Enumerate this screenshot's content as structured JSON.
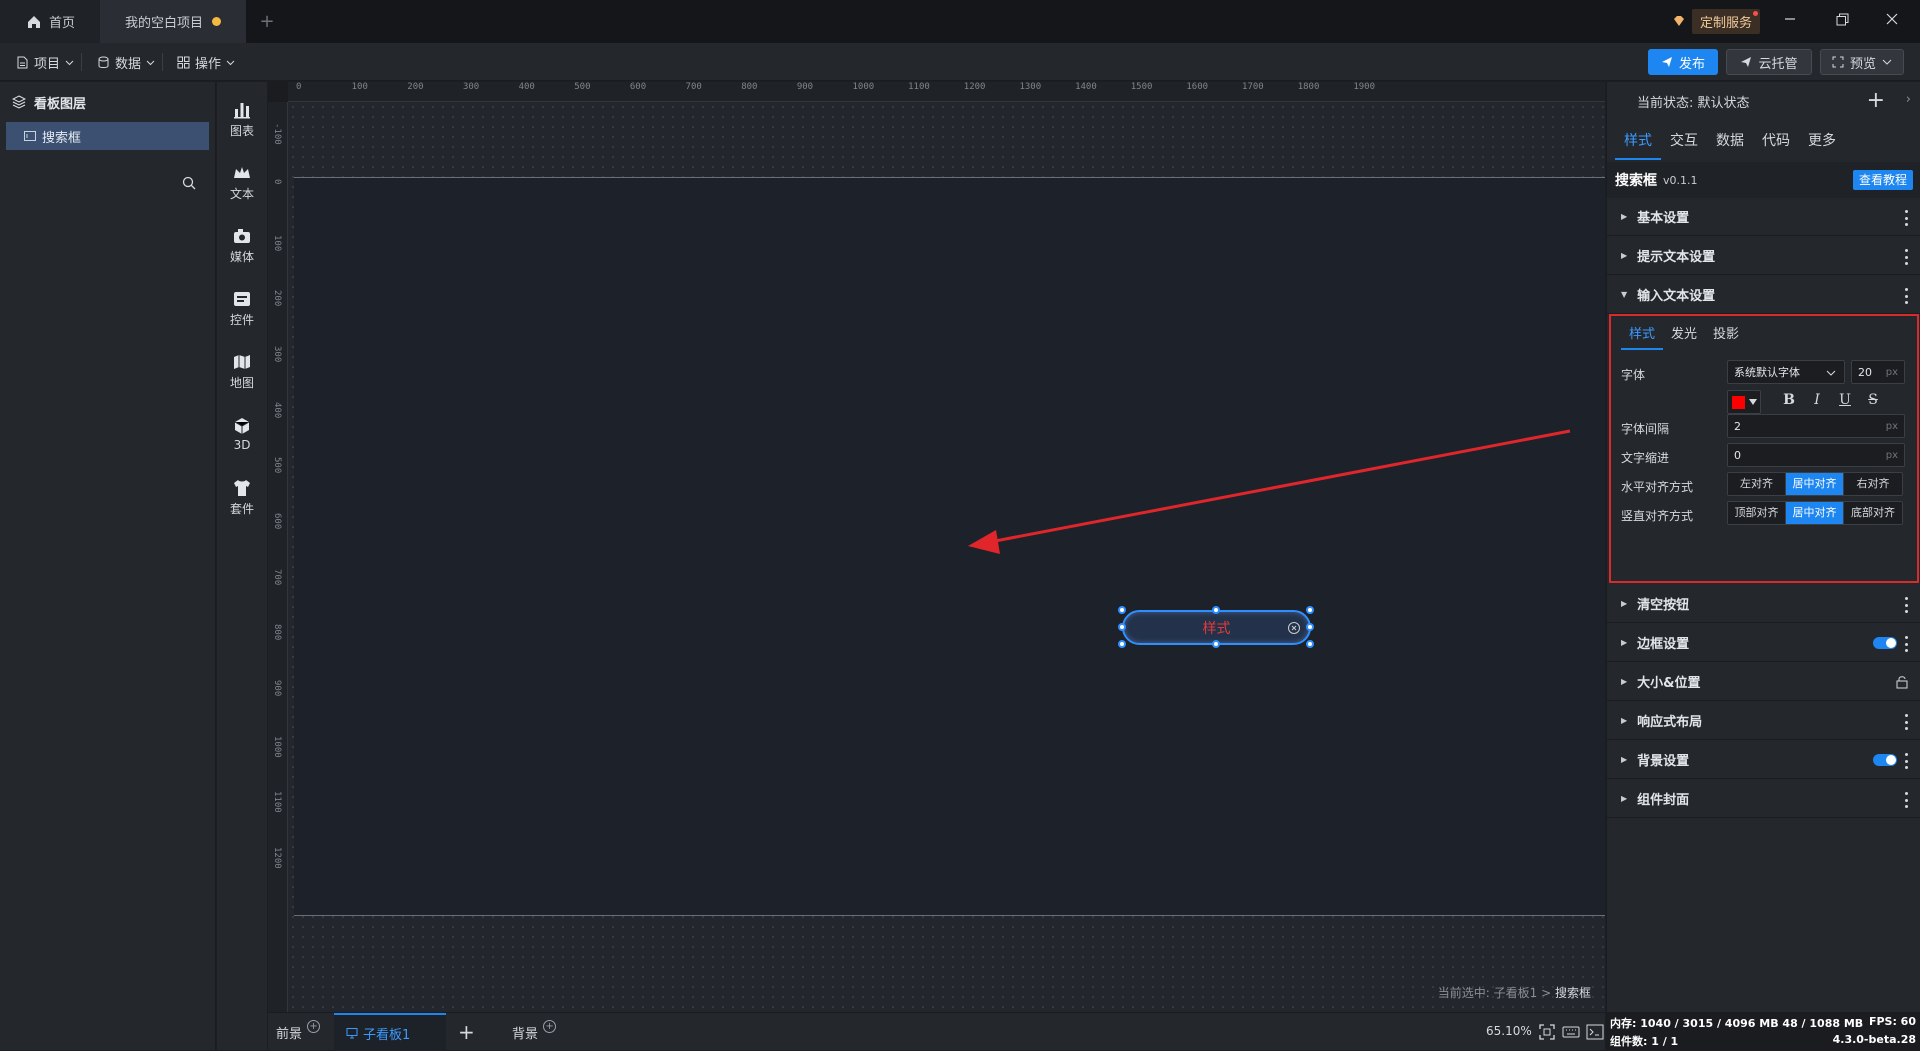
{
  "titlebar": {
    "home_tab": "首页",
    "project_tab": "我的空白项目",
    "custom_service": "定制服务"
  },
  "menubar": {
    "project": "项目",
    "data": "数据",
    "ops": "操作",
    "publish": "发布",
    "cloud": "云托管",
    "preview": "预览"
  },
  "layers": {
    "title": "看板图层",
    "items": [
      "搜索框"
    ]
  },
  "library": {
    "items": [
      "图表",
      "文本",
      "媒体",
      "控件",
      "地图",
      "3D",
      "套件"
    ]
  },
  "canvas": {
    "ruler_h": [
      "0",
      "100",
      "200",
      "300",
      "400",
      "500",
      "600",
      "700",
      "800",
      "900",
      "1000",
      "1100",
      "1200",
      "1300",
      "1400",
      "1500",
      "1600",
      "1700",
      "1800",
      "1900"
    ],
    "ruler_v": [
      "-100",
      "0",
      "100",
      "200",
      "300",
      "400",
      "500",
      "600",
      "700",
      "800",
      "900",
      "1000",
      "1100",
      "1200"
    ],
    "search_text": "样式",
    "breadcrumb_prefix": "当前选中: 子看板1 >",
    "breadcrumb_current": "搜索框"
  },
  "bottombar": {
    "foreground": "前景",
    "subboard": "子看板1",
    "background": "背景",
    "zoom": "65.10%"
  },
  "rightpanel": {
    "state_label": "当前状态:",
    "state_value": "默认状态",
    "tabs": [
      "样式",
      "交互",
      "数据",
      "代码",
      "更多"
    ],
    "component_name": "搜索框",
    "version": "v0.1.1",
    "tutorial": "查看教程",
    "sections_top": [
      "基本设置",
      "提示文本设置",
      "输入文本设置"
    ],
    "sections_bottom": [
      "清空按钮",
      "边框设置",
      "大小&位置",
      "响应式布局",
      "背景设置",
      "组件封面"
    ],
    "sub_tabs": [
      "样式",
      "发光",
      "投影"
    ],
    "font_label": "字体",
    "font_family": "系统默认字体",
    "font_size": "20",
    "unit_px": "px",
    "font_color": "#ff0000",
    "letter_spacing_label": "字体间隔",
    "letter_spacing": "2",
    "indent_label": "文字缩进",
    "indent": "0",
    "h_align_label": "水平对齐方式",
    "h_align_options": [
      "左对齐",
      "居中对齐",
      "右对齐"
    ],
    "v_align_label": "竖直对齐方式",
    "v_align_options": [
      "顶部对齐",
      "居中对齐",
      "底部对齐"
    ]
  },
  "statusbar": {
    "memory": "内存: 1040 / 3015 / 4096 MB  48 / 1088 MB",
    "fps": "FPS: 60",
    "components": "组件数: 1 / 1",
    "version": "4.3.0-beta.28"
  },
  "colors": {
    "accent": "#1e86f0",
    "highlight_box": "#d92b2b",
    "arrow": "#e0262b"
  }
}
